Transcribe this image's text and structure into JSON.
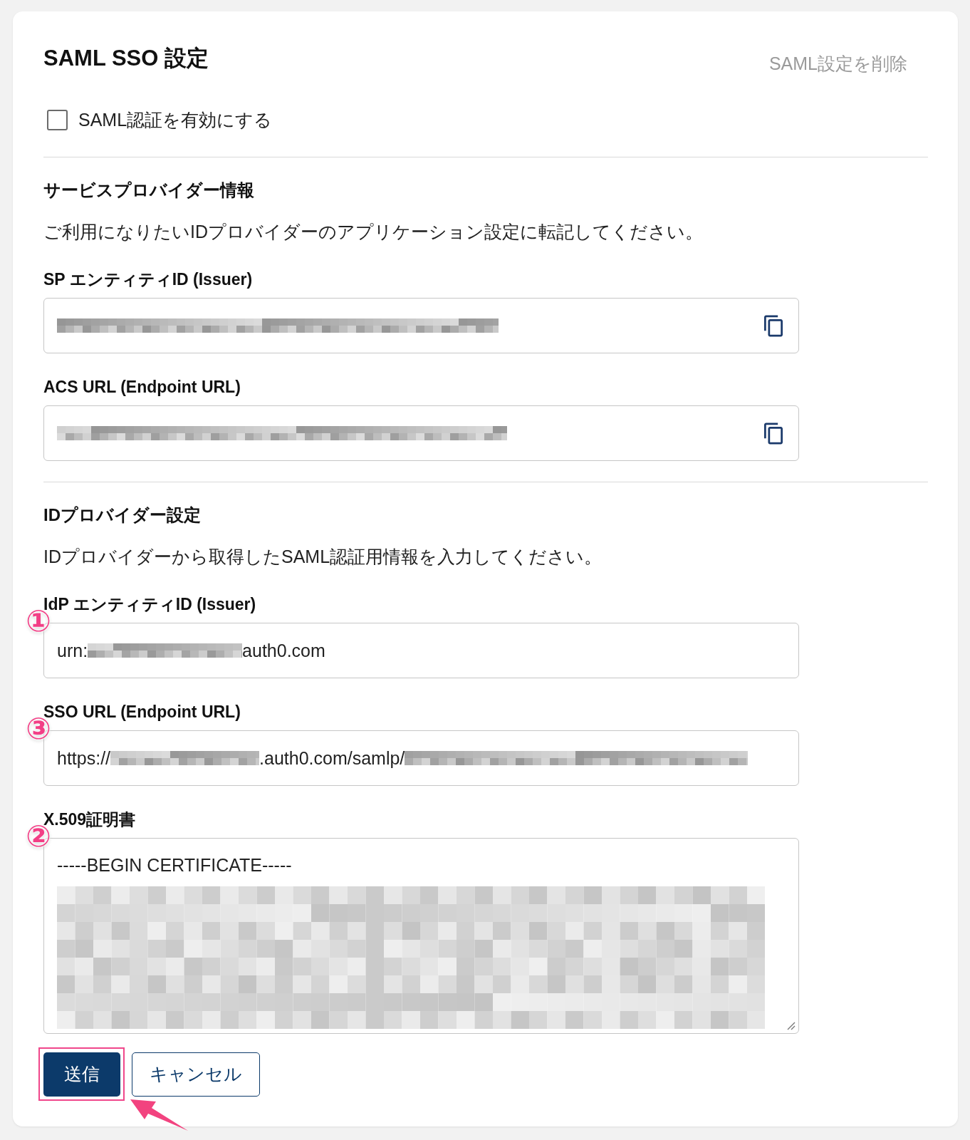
{
  "header": {
    "title": "SAML SSO 設定",
    "delete_link": "SAML設定を削除"
  },
  "enable_saml": {
    "label": "SAML認証を有効にする",
    "checked": false
  },
  "sections": [
    {
      "heading": "サービスプロバイダー情報",
      "description": "ご利用になりたいIDプロバイダーのアプリケーション設定に転記してください。",
      "fields": [
        {
          "label": "SP エンティティID (Issuer)",
          "kind": "input",
          "copy_button": true,
          "value": [
            {
              "kind": "redacted"
            }
          ]
        },
        {
          "label": "ACS URL (Endpoint URL)",
          "kind": "input",
          "copy_button": true,
          "value": [
            {
              "kind": "redacted"
            }
          ]
        }
      ]
    },
    {
      "heading": "IDプロバイダー設定",
      "description": "IDプロバイダーから取得したSAML認証用情報を入力してください。",
      "fields": [
        {
          "label": "IdP エンティティID (Issuer)",
          "kind": "input",
          "copy_button": false,
          "annotation": "①",
          "value": [
            {
              "kind": "text",
              "text": "urn:"
            },
            {
              "kind": "redacted"
            },
            {
              "kind": "text",
              "text": "auth0.com"
            }
          ]
        },
        {
          "label": "SSO URL (Endpoint URL)",
          "kind": "input",
          "copy_button": false,
          "annotation": "③",
          "value": [
            {
              "kind": "text",
              "text": "https://"
            },
            {
              "kind": "redacted"
            },
            {
              "kind": "text",
              "text": ".auth0.com/samlp/"
            },
            {
              "kind": "redacted"
            }
          ]
        },
        {
          "label": "X.509証明書",
          "kind": "textarea",
          "copy_button": false,
          "annotation": "②",
          "value": [
            {
              "kind": "text",
              "text": "-----BEGIN CERTIFICATE-----"
            },
            {
              "kind": "redacted"
            }
          ]
        }
      ]
    }
  ],
  "buttons": [
    {
      "label": "送信",
      "kind": "primary",
      "highlighted": true
    },
    {
      "label": "キャンセル",
      "kind": "secondary",
      "highlighted": false
    }
  ]
}
